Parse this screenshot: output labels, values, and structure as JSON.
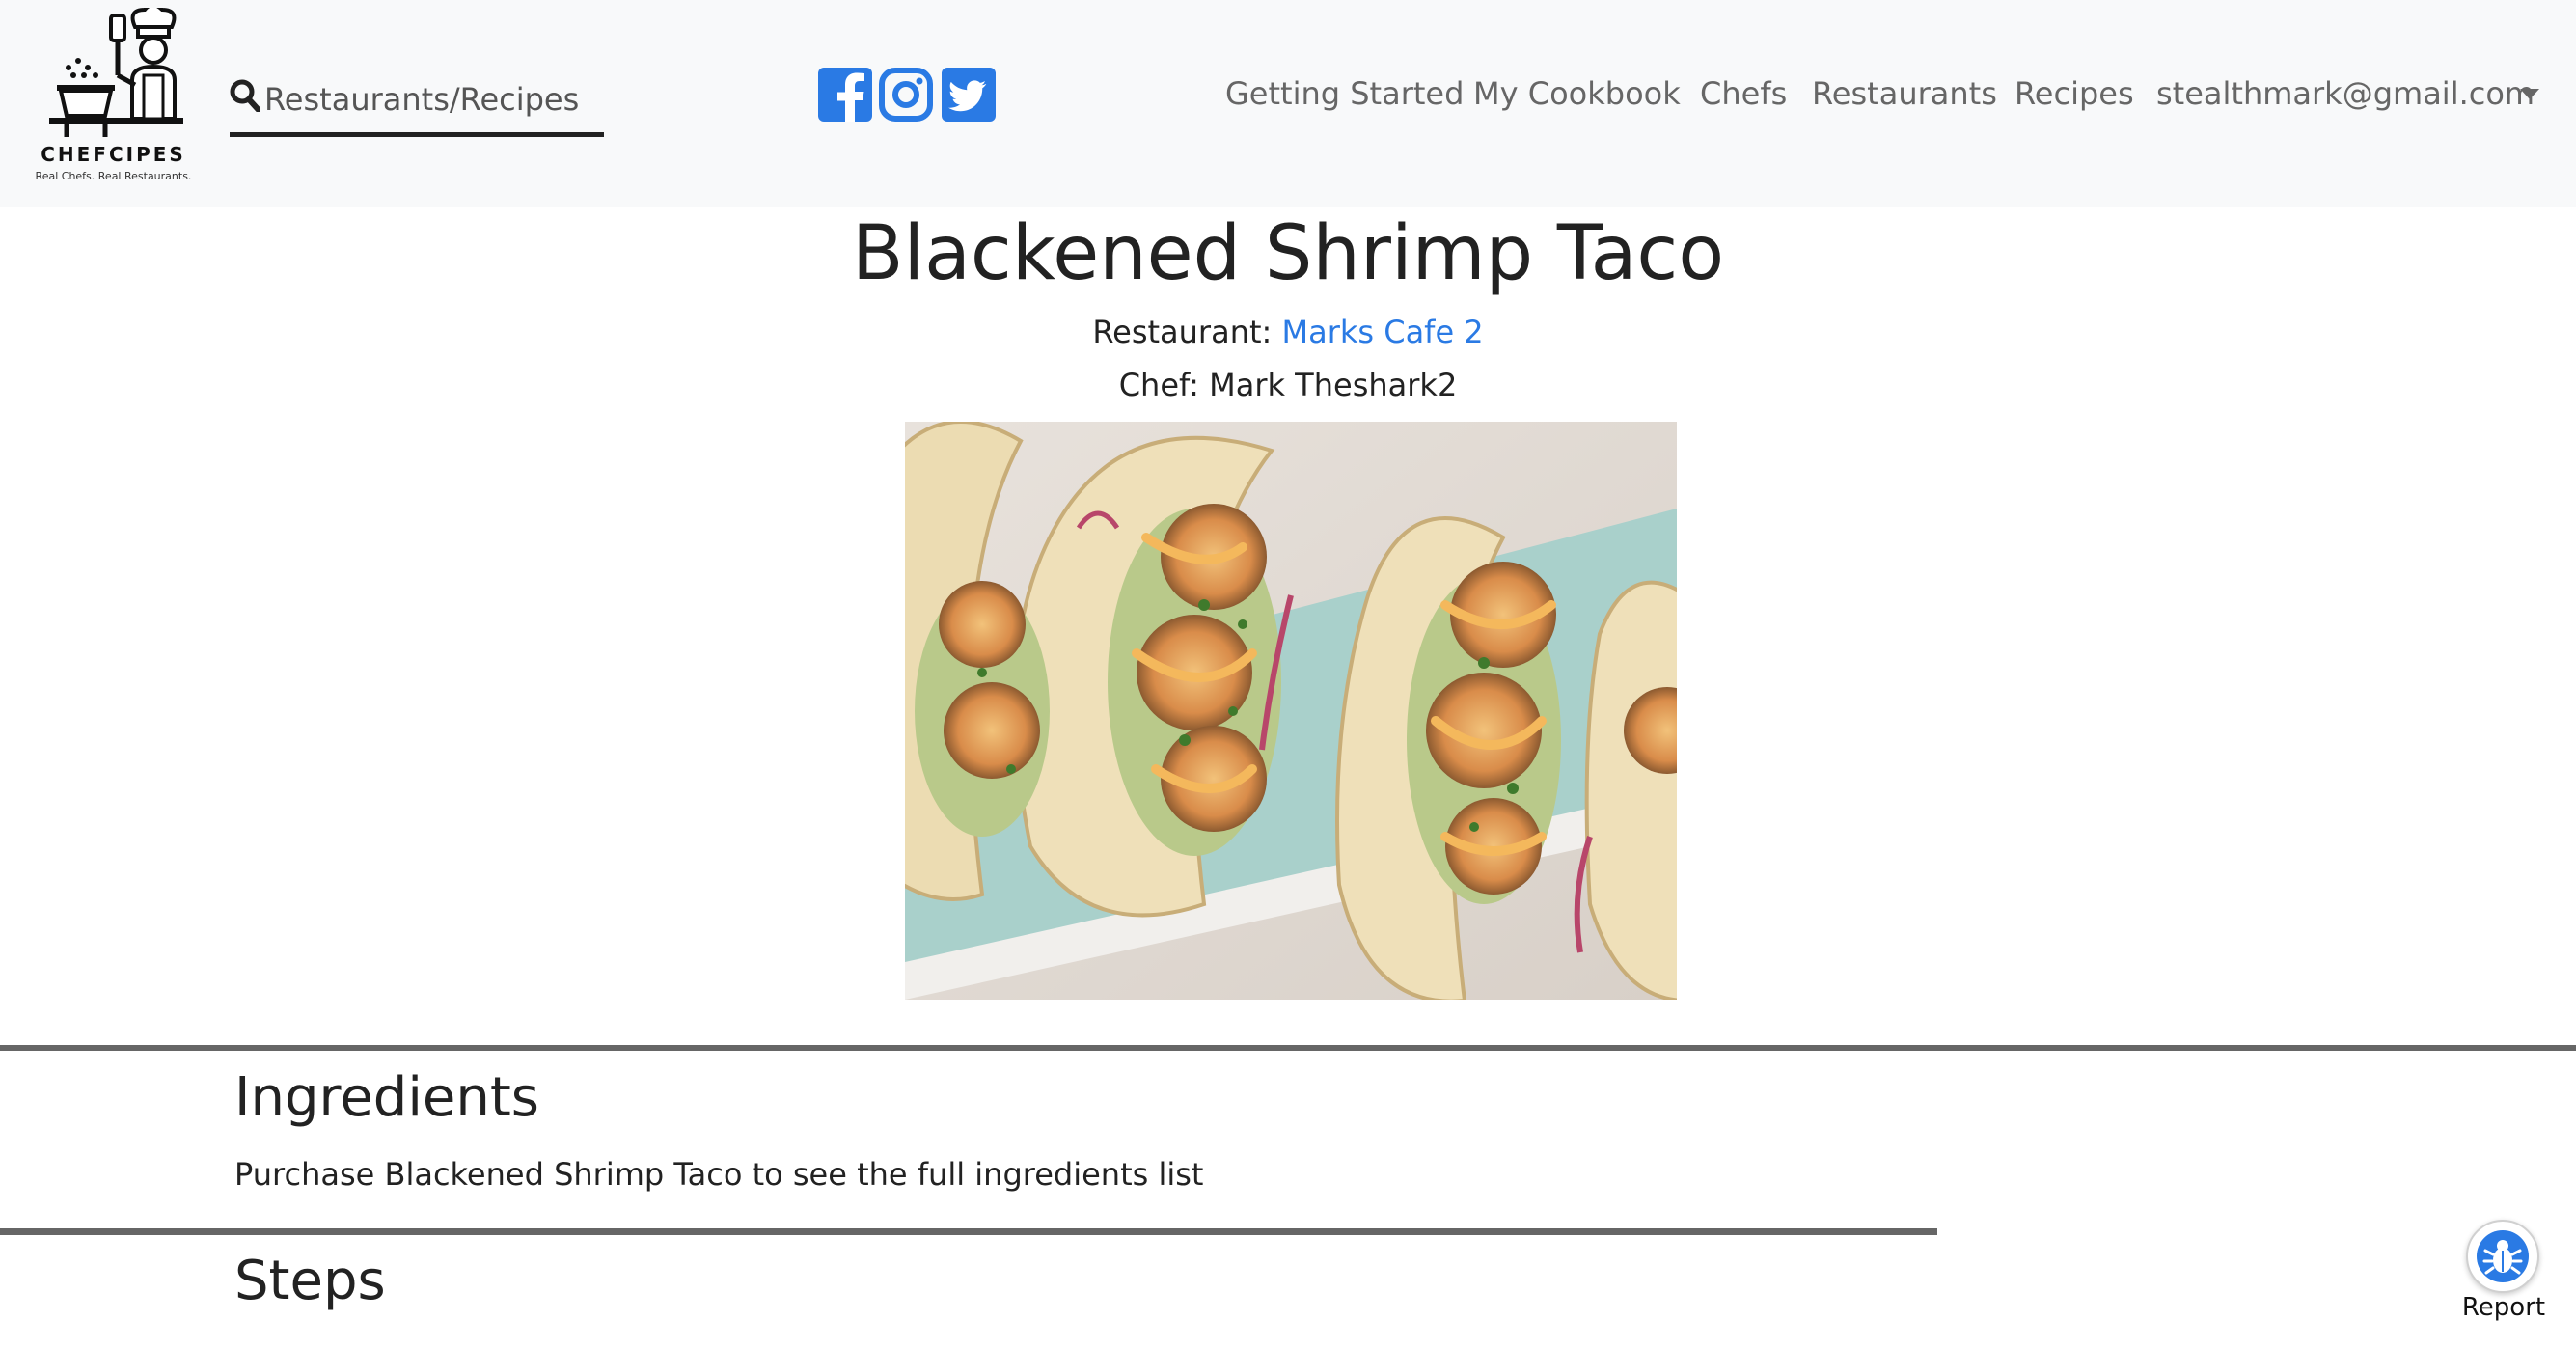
{
  "brand": {
    "name": "Chefcipes",
    "tagline": "Real Chefs.  Real Restaurants."
  },
  "search": {
    "placeholder": "Restaurants/Recipes"
  },
  "social": [
    "facebook-icon",
    "instagram-icon",
    "twitter-icon"
  ],
  "nav": {
    "items": [
      {
        "label": "Getting Started"
      },
      {
        "label": "My Cookbook"
      },
      {
        "label": "Chefs"
      },
      {
        "label": "Restaurants"
      },
      {
        "label": "Recipes"
      }
    ],
    "user": "stealthmark@gmail.com"
  },
  "recipe": {
    "title": "Blackened Shrimp Taco",
    "restaurant_label": "Restaurant: ",
    "restaurant_name": "Marks Cafe 2",
    "chef_line": "Chef: Mark Theshark2"
  },
  "ingredients": {
    "heading": "Ingredients",
    "text": "Purchase Blackened Shrimp Taco to see the full ingredients list"
  },
  "steps": {
    "heading": "Steps"
  },
  "report": {
    "label": "Report"
  },
  "colors": {
    "navbar_bg": "#f8f9fa",
    "link": "#2a7ae4",
    "social": "#2a7ae4",
    "divider": "#666666"
  }
}
